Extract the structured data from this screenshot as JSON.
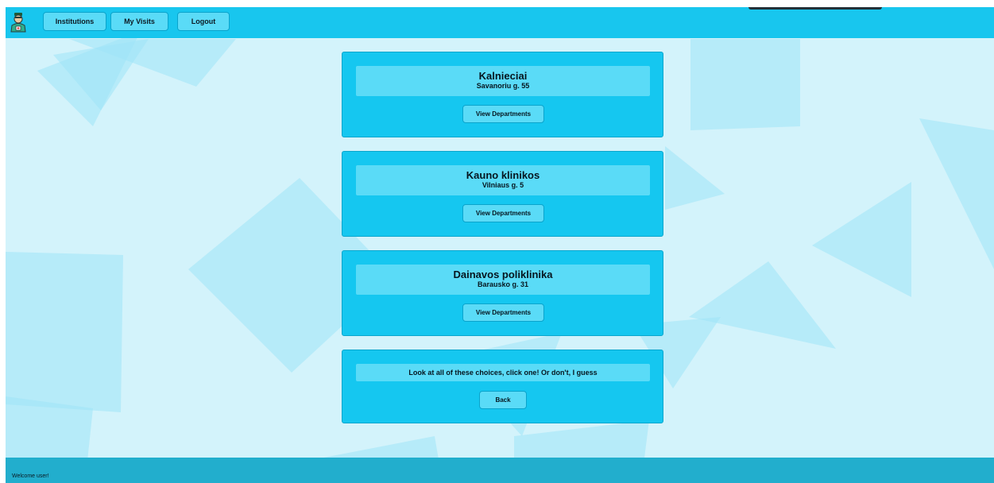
{
  "nav": {
    "logo_icon": "doctor-avatar-icon",
    "buttons": [
      "Institutions",
      "My Visits",
      "Logout"
    ]
  },
  "institutions": [
    {
      "name": "Kalnieciai",
      "address": "Savanoriu g. 55",
      "button": "View Departments"
    },
    {
      "name": "Kauno klinikos",
      "address": "Vilniaus g. 5",
      "button": "View Departments"
    },
    {
      "name": "Dainavos poliklinika",
      "address": "Barausko g. 31",
      "button": "View Departments"
    }
  ],
  "prompt": {
    "message": "Look at all of these choices, click one! Or don't, I guess",
    "back": "Back"
  },
  "footer": {
    "welcome": "Welcome user!"
  },
  "colors": {
    "topbar": "#18c6ee",
    "card": "#15c7f0",
    "inner_box": "#5adbf7",
    "background": "#d3f3fb",
    "footer": "#22aecd"
  }
}
